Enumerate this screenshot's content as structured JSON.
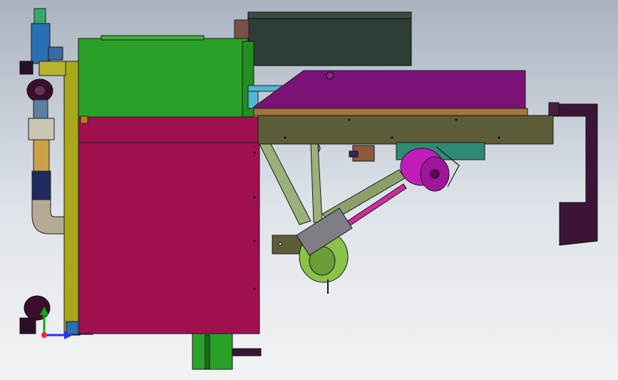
{
  "view": {
    "background_top": "#a9b3c0",
    "background_bottom": "#f2f3f5",
    "orientation_triad": {
      "axes": [
        {
          "name": "x",
          "color": "#2233ff"
        },
        {
          "name": "y",
          "color": "#11aa11"
        },
        {
          "name": "origin",
          "color": "#ff2222"
        }
      ]
    }
  },
  "colors": {
    "green_cabinet": "#29a129",
    "crimson_body": "#a0104e",
    "dark_box": "#2e3d35",
    "magenta_cover": "#7b1277",
    "olive_bed": "#5c5c38",
    "yellow_column": "#a9a81a",
    "frame_lightgreen": "#9bb07a",
    "chute_dark": "#3c1436",
    "blue_valve": "#2a6fb1",
    "pipe_navy": "#1f2b5c",
    "pipe_gold": "#c9a24a",
    "pipe_beige": "#b5aa95",
    "motor_magenta": "#c21dbb",
    "outline": "#1a1a1a"
  },
  "icons": [
    "orientation-triad-icon"
  ]
}
